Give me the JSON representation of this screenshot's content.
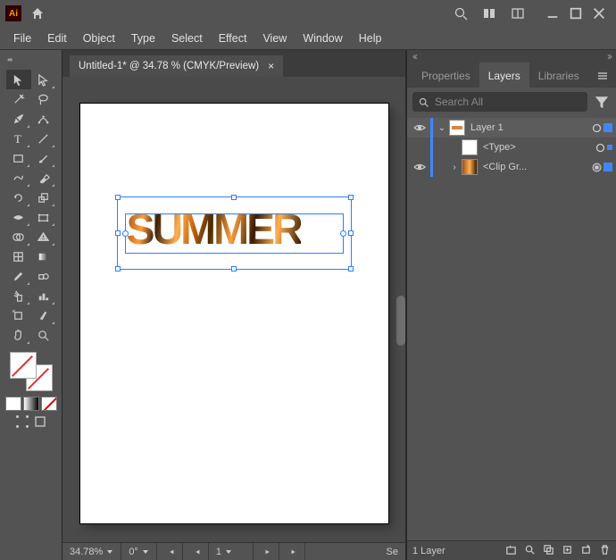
{
  "titlebar": {
    "app_code": "Ai"
  },
  "menu": {
    "file": "File",
    "edit": "Edit",
    "object": "Object",
    "type": "Type",
    "select": "Select",
    "effect": "Effect",
    "view": "View",
    "window": "Window",
    "help": "Help"
  },
  "document": {
    "tab_title": "Untitled-1* @ 34.78 % (CMYK/Preview)",
    "tab_close": "×",
    "artwork_text": "SUMMER"
  },
  "status": {
    "zoom": "34.78%",
    "rotation": "0°",
    "selection": "Se"
  },
  "panels": {
    "tabs": {
      "properties": "Properties",
      "layers": "Layers",
      "libraries": "Libraries"
    },
    "search_placeholder": "Search All",
    "layers": [
      {
        "label": "Layer 1"
      },
      {
        "label": "<Type>"
      },
      {
        "label": "<Clip Gr..."
      }
    ],
    "footer": {
      "count_label": "1 Layer"
    }
  }
}
